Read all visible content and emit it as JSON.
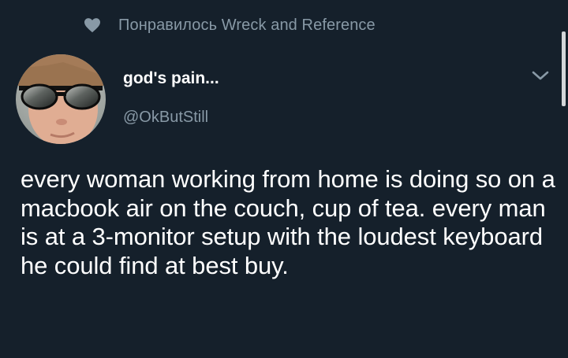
{
  "liked_banner": {
    "icon": "heart-icon",
    "text": "Понравилось Wreck and Reference"
  },
  "tweet": {
    "author": {
      "display_name": "god's pain...",
      "handle": "@OkButStill",
      "avatar": "avatar-person-with-sunglasses"
    },
    "menu_icon": "chevron-down-icon",
    "text": "every woman working from home is doing so on a macbook air on the couch, cup of tea. every man is at a 3-monitor setup with the loudest keyboard he could find at best buy."
  },
  "colors": {
    "background": "#15202b",
    "primary_text": "#ffffff",
    "secondary_text": "#8899a6"
  }
}
